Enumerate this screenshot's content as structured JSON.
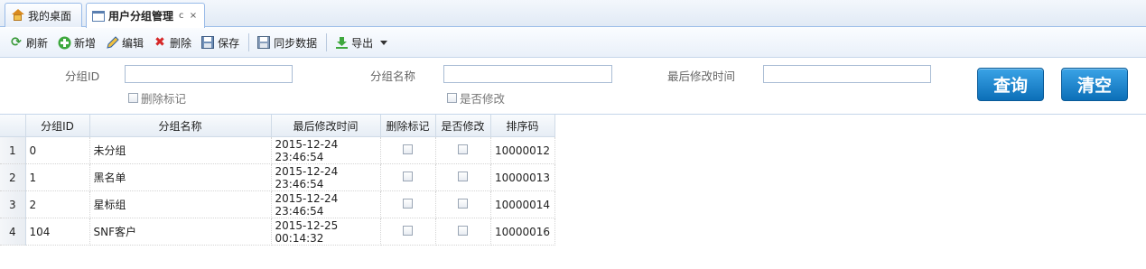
{
  "tabs": [
    {
      "label": "我的桌面",
      "icon": "home-icon"
    },
    {
      "label": "用户分组管理",
      "icon": "window-icon",
      "refresh": "c",
      "close": "×"
    }
  ],
  "toolbar": {
    "refresh": "刷新",
    "add": "新增",
    "edit": "编辑",
    "delete": "删除",
    "save": "保存",
    "sync": "同步数据",
    "export": "导出"
  },
  "form": {
    "group_id_label": "分组ID",
    "group_id_value": "",
    "group_name_label": "分组名称",
    "group_name_value": "",
    "modified_time_label": "最后修改时间",
    "modified_time_value": "",
    "delete_flag_label": "删除标记",
    "is_modified_label": "是否修改",
    "query_button": "查询",
    "clear_button": "清空"
  },
  "grid": {
    "columns": [
      "分组ID",
      "分组名称",
      "最后修改时间",
      "删除标记",
      "是否修改",
      "排序码"
    ],
    "rows": [
      {
        "rownum": "1",
        "id": "0",
        "name": "未分组",
        "time": "2015-12-24 23:46:54",
        "sort": "10000012"
      },
      {
        "rownum": "2",
        "id": "1",
        "name": "黑名单",
        "time": "2015-12-24 23:46:54",
        "sort": "10000013"
      },
      {
        "rownum": "3",
        "id": "2",
        "name": "星标组",
        "time": "2015-12-24 23:46:54",
        "sort": "10000014"
      },
      {
        "rownum": "4",
        "id": "104",
        "name": "SNF客户",
        "time": "2015-12-25 00:14:32",
        "sort": "10000016"
      }
    ]
  },
  "colors": {
    "accent": "#0c6fb8",
    "border": "#99bbe8"
  }
}
